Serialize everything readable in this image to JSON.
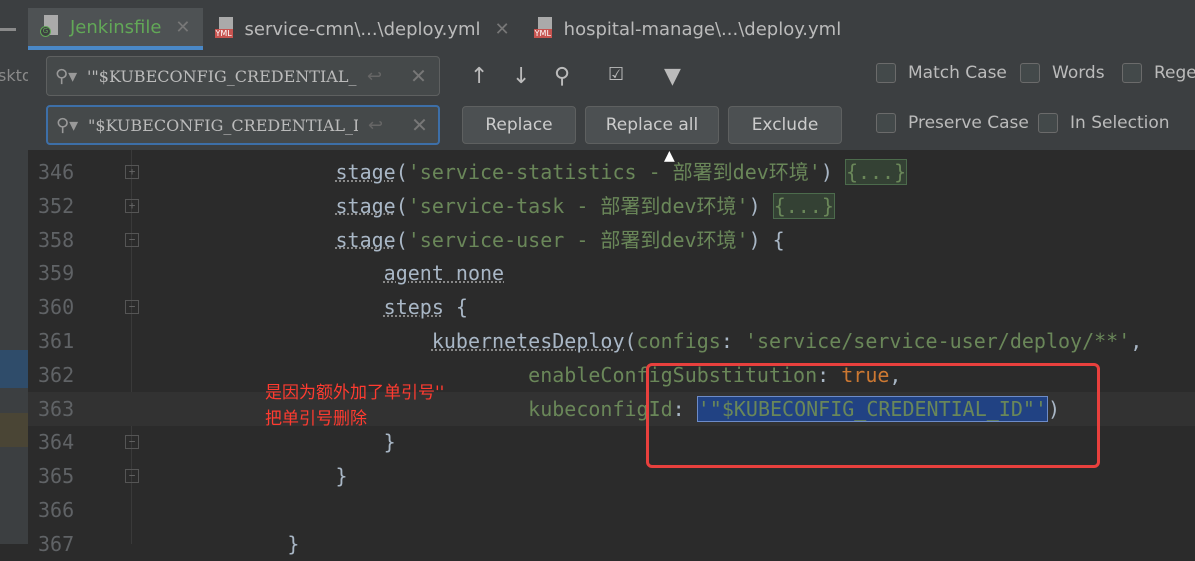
{
  "left_panel": {
    "label": "skto"
  },
  "tabs": [
    {
      "label": "Jenkinsfile",
      "icon": "groovy-file-icon",
      "active": true
    },
    {
      "label": "service-cmn\\...\\deploy.yml",
      "icon": "yml-file-icon",
      "active": false
    },
    {
      "label": "hospital-manage\\...\\deploy.yml",
      "icon": "yml-file-icon",
      "active": false
    }
  ],
  "find": {
    "search_value": "'\"$KUBECONFIG_CREDENTIAL_ID\"'",
    "replace_value": "\"$KUBECONFIG_CREDENTIAL_ID\"",
    "replace_label": "Replace",
    "replace_all_label": "Replace all",
    "exclude_label": "Exclude",
    "match_case": "Match Case",
    "words": "Words",
    "regex": "Rege",
    "preserve_case": "Preserve Case",
    "in_selection": "In Selection",
    "yml_badge": "YML",
    "g_badge": "G"
  },
  "code_lines": [
    {
      "num": "346",
      "fold": "+",
      "tokens": [
        {
          "t": "            "
        },
        {
          "t": "stage",
          "c": "kw"
        },
        {
          "t": "("
        },
        {
          "t": "'service-statistics - 部署到dev环境'",
          "c": "str"
        },
        {
          "t": ") "
        },
        {
          "t": "{...}",
          "c": "fold-region"
        }
      ]
    },
    {
      "num": "352",
      "fold": "+",
      "tokens": [
        {
          "t": "            "
        },
        {
          "t": "stage",
          "c": "kw"
        },
        {
          "t": "("
        },
        {
          "t": "'service-task - 部署到dev环境'",
          "c": "str"
        },
        {
          "t": ") "
        },
        {
          "t": "{...}",
          "c": "fold-region"
        }
      ]
    },
    {
      "num": "358",
      "fold": "-",
      "tokens": [
        {
          "t": "            "
        },
        {
          "t": "stage",
          "c": "kw"
        },
        {
          "t": "("
        },
        {
          "t": "'service-user - 部署到dev环境'",
          "c": "str"
        },
        {
          "t": ") {"
        }
      ]
    },
    {
      "num": "359",
      "fold": "",
      "tokens": [
        {
          "t": "                "
        },
        {
          "t": "agent none",
          "c": "kw"
        }
      ]
    },
    {
      "num": "360",
      "fold": "-",
      "tokens": [
        {
          "t": "                "
        },
        {
          "t": "steps",
          "c": "kw"
        },
        {
          "t": " {"
        }
      ]
    },
    {
      "num": "361",
      "fold": "",
      "tokens": [
        {
          "t": "                    "
        },
        {
          "t": "kubernetesDeploy",
          "c": "kw"
        },
        {
          "t": "("
        },
        {
          "t": "configs",
          "c": "param"
        },
        {
          "t": ": "
        },
        {
          "t": "'service/service-user/deploy/**'",
          "c": "str"
        },
        {
          "t": ","
        }
      ]
    },
    {
      "num": "362",
      "fold": "",
      "tokens": [
        {
          "t": "                            "
        },
        {
          "t": "enableConfigSubstitution",
          "c": "param"
        },
        {
          "t": ": "
        },
        {
          "t": "true",
          "c": "bool"
        },
        {
          "t": ","
        }
      ]
    },
    {
      "num": "363",
      "fold": "",
      "current": true,
      "tokens": [
        {
          "t": "                            "
        },
        {
          "t": "kubeconfigId",
          "c": "param"
        },
        {
          "t": ": "
        },
        {
          "t": "'\"$KUBECONFIG_CREDENTIAL_ID\"'",
          "c": "str sel"
        },
        {
          "t": ")"
        }
      ]
    },
    {
      "num": "364",
      "fold": "-",
      "tokens": [
        {
          "t": "                "
        },
        {
          "t": "}"
        }
      ]
    },
    {
      "num": "365",
      "fold": "-",
      "tokens": [
        {
          "t": "            "
        },
        {
          "t": "}"
        }
      ]
    },
    {
      "num": "366",
      "fold": "",
      "tokens": [
        {
          "t": ""
        }
      ]
    },
    {
      "num": "367",
      "fold": "",
      "tokens": [
        {
          "t": "        "
        },
        {
          "t": "}"
        }
      ]
    }
  ],
  "annotation": {
    "line1": "是因为额外加了单引号''",
    "line2": "把单引号删除"
  },
  "colors": {
    "annotation": "#ff3b30",
    "highlight_box": "#e8403d",
    "selection": "#214283"
  }
}
